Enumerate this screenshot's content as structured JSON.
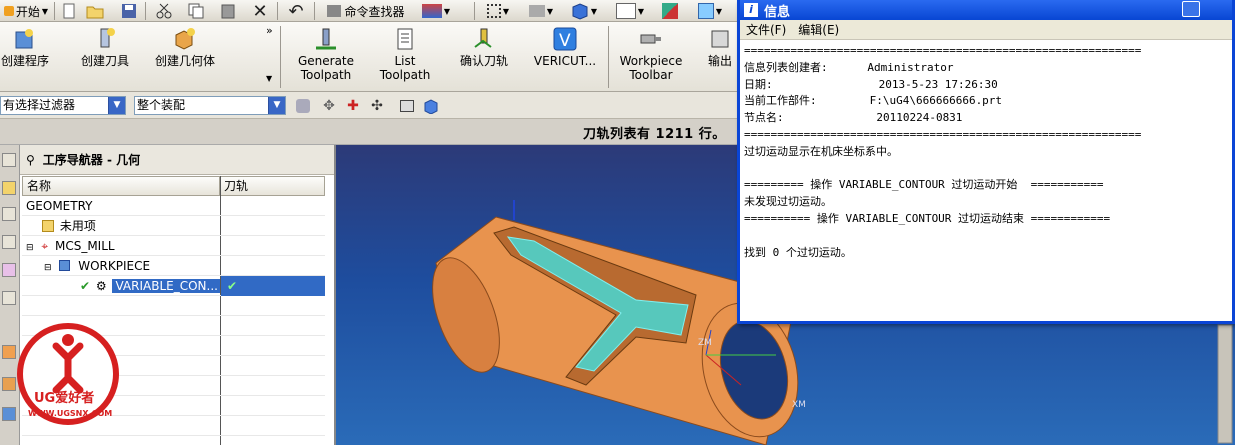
{
  "toolbar_top": {
    "start_label": "开始",
    "command_finder_label": "命令查找器"
  },
  "toolbar_big": [
    {
      "label": "创建程序"
    },
    {
      "label": "创建刀具"
    },
    {
      "label": "创建几何体"
    },
    {
      "label": "Generate\nToolpath"
    },
    {
      "label": "List\nToolpath"
    },
    {
      "label": "确认刀轨"
    },
    {
      "label": "VERICUT..."
    },
    {
      "label": "Workpiece\nToolbar"
    },
    {
      "label": "输出"
    }
  ],
  "filters": {
    "selection_filter": "有选择过滤器",
    "assembly_scope": "整个装配"
  },
  "status_message": "刀轨列表有 1211 行。",
  "navigator": {
    "title": "工序导航器 - 几何",
    "col_name": "名称",
    "col_toolpath": "刀轨",
    "rows": [
      {
        "name": "GEOMETRY",
        "indent": 0
      },
      {
        "name": "未用项",
        "indent": 1
      },
      {
        "name": "MCS_MILL",
        "indent": 1
      },
      {
        "name": "WORKPIECE",
        "indent": 2
      },
      {
        "name": "VARIABLE_CON...",
        "indent": 3,
        "toolpath": "✔"
      }
    ]
  },
  "info_window": {
    "title": "信息",
    "menu_file": "文件(F)",
    "menu_edit": "编辑(E)",
    "lines": [
      "============================================================",
      "信息列表创建者:      Administrator",
      "日期:                2013-5-23 17:26:30",
      "当前工作部件:        F:\\uG4\\666666666.prt",
      "节点名:              20110224-0831",
      "============================================================",
      "过切运动显示在机床坐标系中。",
      "",
      "========= 操作 VARIABLE_CONTOUR 过切运动开始  ===========",
      "未发现过切运动。",
      "========== 操作 VARIABLE_CONTOUR 过切运动结束 ============",
      "",
      "找到 0 个过切运动。"
    ]
  },
  "viewport": {
    "axis_labels": {
      "zm": "ZM",
      "xm": "XM"
    }
  },
  "watermark": {
    "brand": "UG爱好者",
    "url": "WWW.UGSNX.COM"
  },
  "colors": {
    "title_bar": "#0846d3",
    "selection": "#316ac5",
    "part_orange": "#e8934e",
    "toolpath_cyan": "#3fe0e0",
    "viewport_bg": "#1e4d9e"
  }
}
